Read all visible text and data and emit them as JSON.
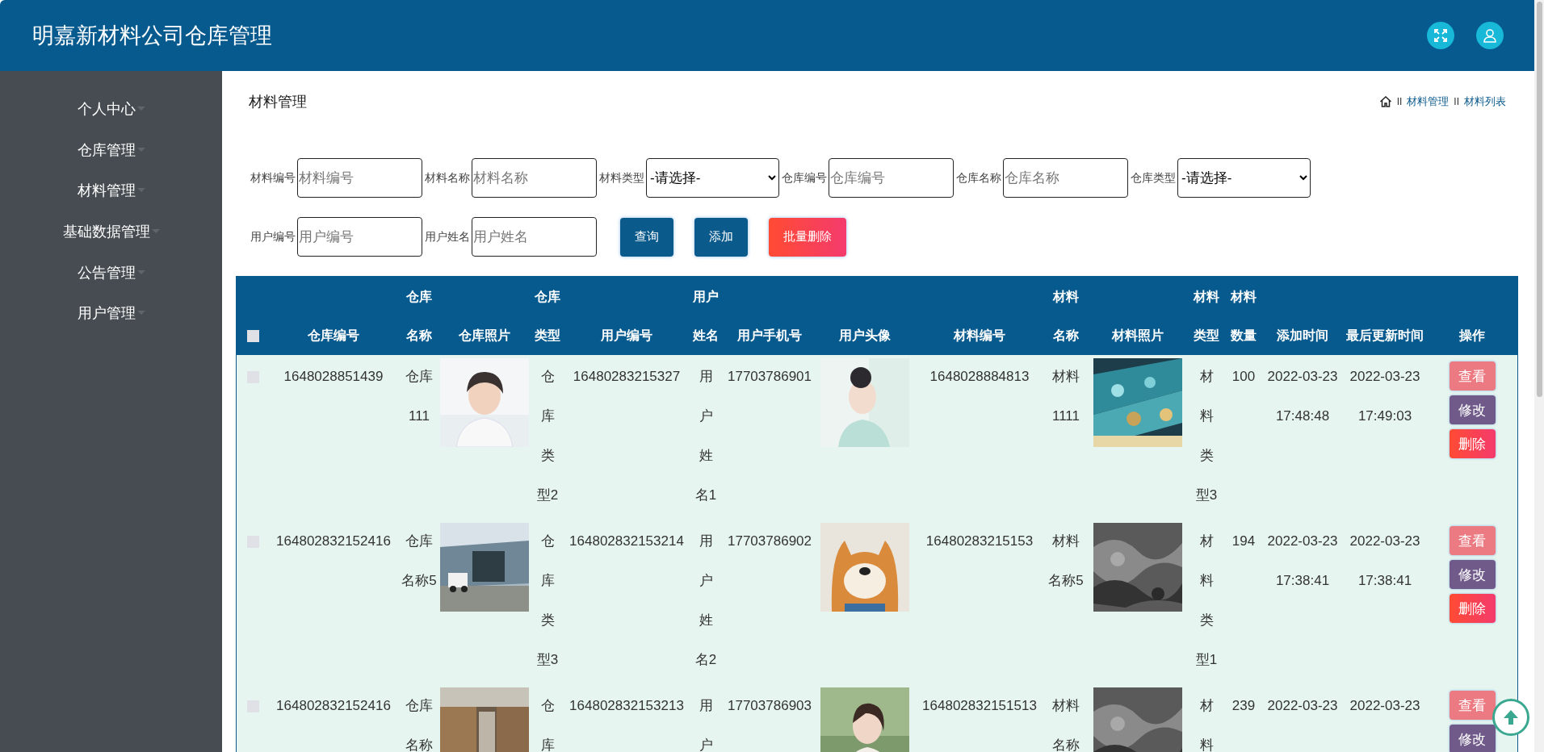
{
  "header": {
    "title": "明嘉新材料公司仓库管理"
  },
  "sidebar": {
    "items": [
      {
        "label": "个人中心"
      },
      {
        "label": "仓库管理"
      },
      {
        "label": "材料管理"
      },
      {
        "label": "基础数据管理"
      },
      {
        "label": "公告管理"
      },
      {
        "label": "用户管理"
      }
    ]
  },
  "page": {
    "title": "材料管理",
    "breadcrumb": [
      {
        "separator": "II",
        "label": "材料管理"
      },
      {
        "separator": "II",
        "label": "材料列表"
      }
    ]
  },
  "filters": [
    [
      {
        "kind": "input",
        "label": "材料编号",
        "placeholder": "材料编号"
      },
      {
        "kind": "input",
        "label": "材料名称",
        "placeholder": "材料名称"
      },
      {
        "kind": "select",
        "label": "材料类型",
        "value": "-请选择-"
      },
      {
        "kind": "input",
        "label": "仓库编号",
        "placeholder": "仓库编号"
      },
      {
        "kind": "input",
        "label": "仓库名称",
        "placeholder": "仓库名称"
      },
      {
        "kind": "select",
        "label": "仓库类型",
        "value": "-请选择-"
      }
    ],
    [
      {
        "kind": "input",
        "label": "用户编号",
        "placeholder": "用户编号"
      },
      {
        "kind": "input",
        "label": "用户姓名",
        "placeholder": "用户姓名"
      }
    ]
  ],
  "actions": [
    {
      "kind": "search",
      "label": "查询"
    },
    {
      "kind": "add",
      "label": "添加"
    },
    {
      "kind": "batch-delete",
      "label": "批量删除"
    }
  ],
  "table": {
    "select_all": {
      "checked": false
    },
    "columns": [
      "仓库编号",
      "仓库名称",
      "仓库照片",
      "仓库类型",
      "用户编号",
      "用户姓名",
      "用户手机号",
      "用户头像",
      "材料编号",
      "材料名称",
      "材料照片",
      "材料类型",
      "材料数量",
      "添加时间",
      "最后更新时间",
      "操作"
    ],
    "rows": [
      {
        "checked": false,
        "cells": [
          "1648028851439",
          "仓库111",
          {
            "kind": "picture"
          },
          "仓库类型2",
          "16480283215327",
          "用户姓名1",
          "17703786901",
          {
            "kind": "picture"
          },
          "1648028884813",
          "材料1111",
          {
            "kind": "picture"
          },
          "材料类型3",
          "100",
          "2022-03-23 17:48:48",
          "2022-03-23 17:49:03"
        ],
        "buttons": [
          {
            "kind": "view",
            "label": "查看"
          },
          {
            "kind": "edit",
            "label": "修改"
          },
          {
            "kind": "delete",
            "label": "删除"
          }
        ]
      },
      {
        "checked": false,
        "cells": [
          "164802832152416",
          "仓库名称5",
          {
            "kind": "picture"
          },
          "仓库类型3",
          "164802832153214",
          "用户姓名2",
          "17703786902",
          {
            "kind": "picture"
          },
          "16480283215153",
          "材料名称5",
          {
            "kind": "picture"
          },
          "材料类型1",
          "194",
          "2022-03-23 17:38:41",
          "2022-03-23 17:38:41"
        ],
        "buttons": [
          {
            "kind": "view",
            "label": "查看"
          },
          {
            "kind": "edit",
            "label": "修改"
          },
          {
            "kind": "delete",
            "label": "删除"
          }
        ]
      },
      {
        "checked": false,
        "cells": [
          "164802832152416",
          "仓库名称",
          {
            "kind": "picture"
          },
          "仓库",
          "164802832153213",
          "用户",
          "17703786903",
          {
            "kind": "picture"
          },
          "164802832151513",
          "材料名称",
          {
            "kind": "picture"
          },
          "材料",
          "239",
          "2022-03-23",
          "2022-03-23"
        ],
        "buttons": [
          {
            "kind": "view",
            "label": "查看"
          },
          {
            "kind": "edit",
            "label": "修改"
          }
        ]
      }
    ]
  }
}
